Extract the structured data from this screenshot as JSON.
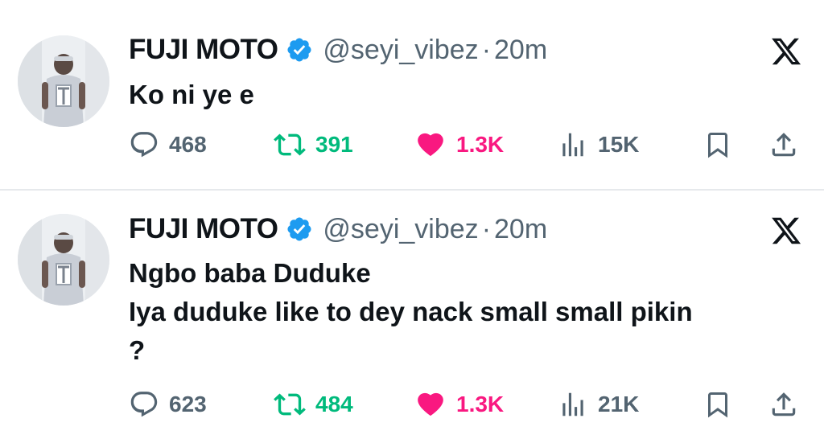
{
  "tweets": [
    {
      "author": {
        "name": "FUJI MOTO",
        "handle": "@seyi_vibez",
        "verified": true
      },
      "separator": "·",
      "time": "20m",
      "lines": [
        "Ko ni ye e"
      ],
      "stats": {
        "replies": "468",
        "reposts": "391",
        "likes": "1.3K",
        "views": "15K"
      },
      "liked": true
    },
    {
      "author": {
        "name": "FUJI MOTO",
        "handle": "@seyi_vibez",
        "verified": true
      },
      "separator": "·",
      "time": "20m",
      "lines": [
        "Ngbo baba Duduke",
        "Iya duduke like to dey nack small small pikin",
        "?"
      ],
      "stats": {
        "replies": "623",
        "reposts": "484",
        "likes": "1.3K",
        "views": "21K"
      },
      "liked": true
    }
  ],
  "icons": {
    "reply": "speech-bubble-icon",
    "repost": "repost-arrows-icon",
    "like": "heart-icon",
    "views": "bar-chart-icon",
    "bookmark": "bookmark-icon",
    "share": "share-upload-icon",
    "brand": "x-logo-icon",
    "verified": "verified-badge-icon"
  },
  "colors": {
    "text": "#0f1419",
    "secondary": "#536471",
    "verified": "#1d9bf0",
    "repost": "#00ba7c",
    "like": "#f91880",
    "divider": "#e6e9ec"
  }
}
